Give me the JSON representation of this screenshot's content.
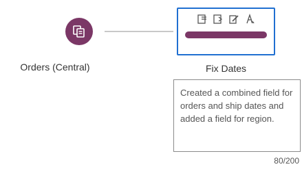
{
  "flow": {
    "input_node": {
      "label": "Orders (Central)",
      "icon": "data-source-icon",
      "color": "#7b3766"
    },
    "clean_step": {
      "label": "Fix Dates",
      "icons": [
        "merge-fields-icon",
        "rename-field-icon",
        "edit-values-icon",
        "calculated-field-icon"
      ],
      "border_color": "#1f6fd1",
      "bar_color": "#7b3766"
    },
    "description": {
      "text": "Created a combined field for orders and ship dates and added a field for region.",
      "char_count": "80/200"
    }
  }
}
